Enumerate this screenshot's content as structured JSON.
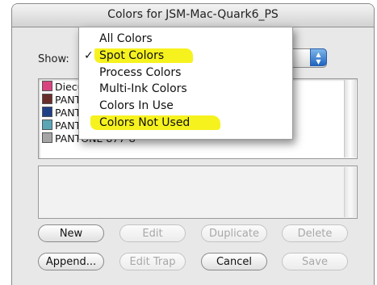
{
  "window": {
    "title": "Colors for JSM-Mac-Quark6_PS"
  },
  "show": {
    "label": "Show:",
    "selected": "Spot Colors"
  },
  "menu": {
    "items": [
      {
        "label": "All Colors",
        "checked": false,
        "highlighted": false
      },
      {
        "label": "Spot Colors",
        "checked": true,
        "highlighted": true
      },
      {
        "label": "Process Colors",
        "checked": false,
        "highlighted": false
      },
      {
        "label": "Multi-Ink Colors",
        "checked": false,
        "highlighted": false
      },
      {
        "label": "Colors In Use",
        "checked": false,
        "highlighted": false
      },
      {
        "label": "Colors Not Used",
        "checked": false,
        "highlighted": true
      }
    ],
    "check_mark": "✓",
    "highlight_color": "#f6f21e"
  },
  "color_list": [
    {
      "label": "Diecut",
      "color": "#d9437f"
    },
    {
      "label": "PANT",
      "color": "#6a2e2a"
    },
    {
      "label": "PANT",
      "color": "#1f3f86"
    },
    {
      "label": "PANT",
      "color": "#5aa6b4"
    },
    {
      "label": "PANTONE 877 U",
      "color": "#a5a5a5"
    }
  ],
  "buttons": {
    "new": "New",
    "edit": "Edit",
    "duplicate": "Duplicate",
    "delete": "Delete",
    "append": "Append...",
    "edit_trap": "Edit Trap",
    "cancel": "Cancel",
    "save": "Save"
  }
}
